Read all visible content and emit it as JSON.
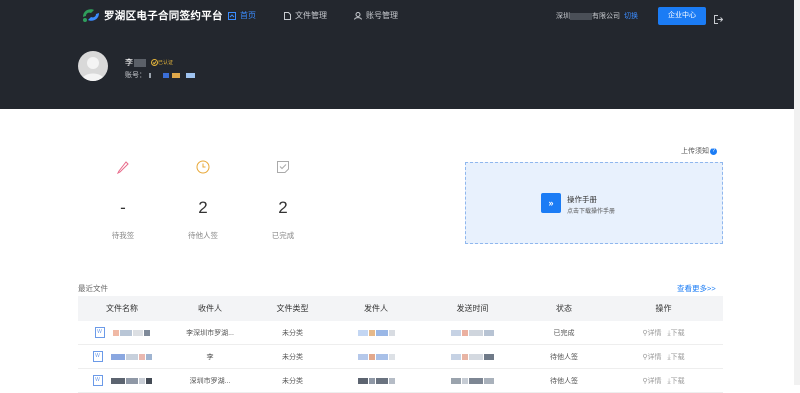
{
  "header": {
    "title": "罗湖区电子合同签约平台",
    "nav": [
      {
        "label": "首页",
        "active": true
      },
      {
        "label": "文件管理",
        "active": false
      },
      {
        "label": "账号管理",
        "active": false
      }
    ],
    "company_prefix": "深圳",
    "company_suffix": "有限公司",
    "switch_label": "切换",
    "business_button": "企业中心",
    "logout_icon": "logout-icon"
  },
  "profile": {
    "name": "李",
    "verified_label": "已认证",
    "account_label": "账号："
  },
  "stats": [
    {
      "value": "-",
      "label": "待我签",
      "icon": "pen-icon"
    },
    {
      "value": "2",
      "label": "待他人签",
      "icon": "clock-icon"
    },
    {
      "value": "2",
      "label": "已完成",
      "icon": "done-icon"
    }
  ],
  "upload_notice": "上传须知",
  "manual": {
    "button": "»",
    "title": "操作手册",
    "subtitle": "点击下载操作手册"
  },
  "recent": {
    "title": "最近文件",
    "more": "查看更多>>"
  },
  "table": {
    "headers": [
      "文件名称",
      "收件人",
      "文件类型",
      "发件人",
      "发送时间",
      "状态",
      "操作"
    ],
    "rows": [
      {
        "receiver": "李深圳市罗湖...",
        "type": "未分类",
        "status": "已完成",
        "detail": "详情",
        "download": "下载"
      },
      {
        "receiver": "李",
        "type": "未分类",
        "status": "待他人签",
        "detail": "详情",
        "download": "下载"
      },
      {
        "receiver": "深圳市罗湖...",
        "type": "未分类",
        "status": "待他人签",
        "detail": "详情",
        "download": "下载"
      }
    ]
  },
  "colors": {
    "header_bg": "#23272e",
    "accent": "#1b7cf5",
    "manual_bg": "#e8f1fd"
  }
}
